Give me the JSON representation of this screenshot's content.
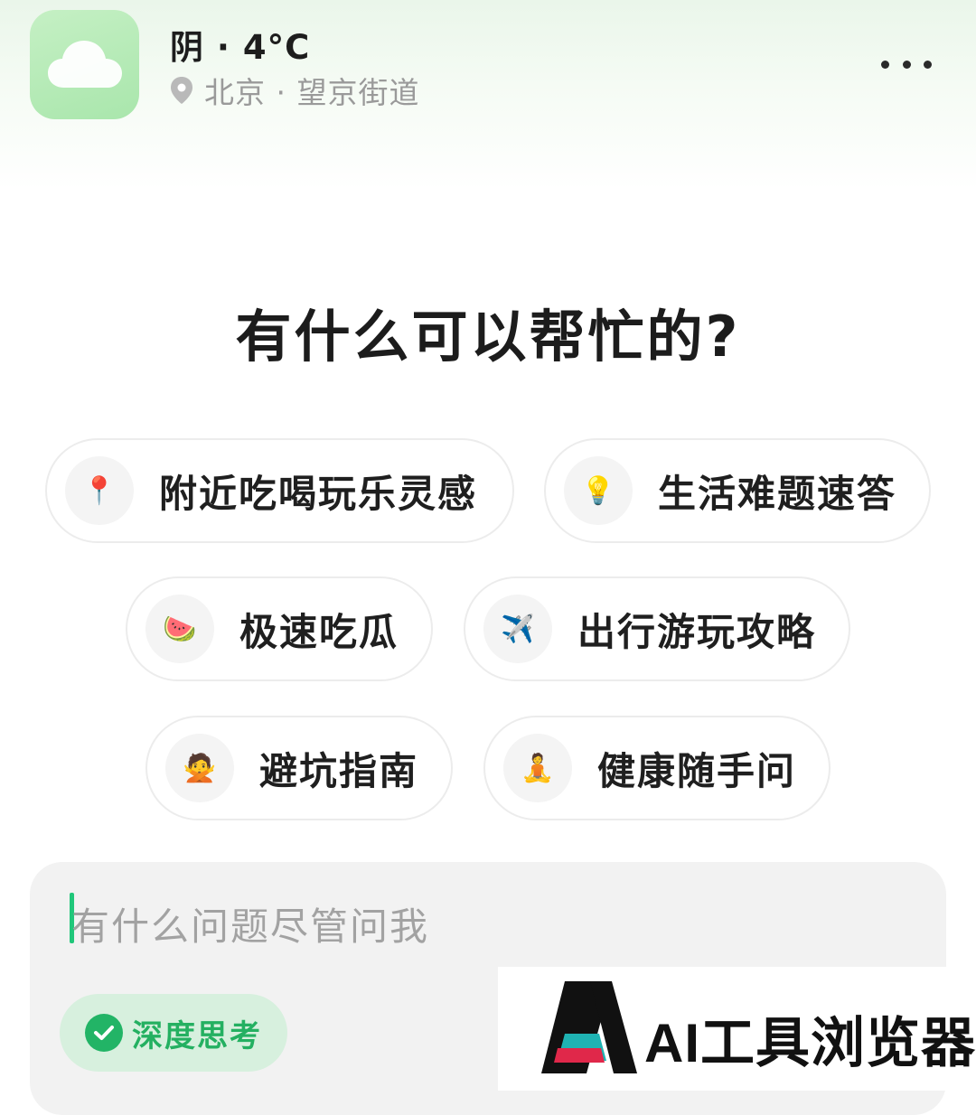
{
  "header": {
    "weather_title": "阴 · 4°C",
    "location": "北京 · 望京街道",
    "weather_icon": "cloud-icon",
    "location_icon": "location-pin-icon",
    "more_icon": "more-dots-icon"
  },
  "headline": "有什么可以帮忙的?",
  "chips": [
    {
      "icon": "📍",
      "icon_name": "round-pushpin",
      "label": "附近吃喝玩乐灵感"
    },
    {
      "icon": "💡",
      "icon_name": "light-bulb",
      "label": "生活难题速答"
    },
    {
      "icon": "🍉",
      "icon_name": "watermelon",
      "label": "极速吃瓜"
    },
    {
      "icon": "✈️",
      "icon_name": "airplane",
      "label": "出行游玩攻略"
    },
    {
      "icon": "🙅",
      "icon_name": "person-gesturing-no",
      "label": "避坑指南"
    },
    {
      "icon": "🧘",
      "icon_name": "person-in-lotus-position",
      "label": "健康随手问"
    }
  ],
  "input": {
    "placeholder": "有什么问题尽管问我",
    "deep_think_label": "深度思考"
  },
  "watermark": {
    "text": "AI工具浏览器"
  },
  "colors": {
    "accent_green": "#22b466",
    "tile_green": "#b8ecb8",
    "chip_bg": "#d7f0de",
    "input_bg": "#f2f2f2"
  }
}
